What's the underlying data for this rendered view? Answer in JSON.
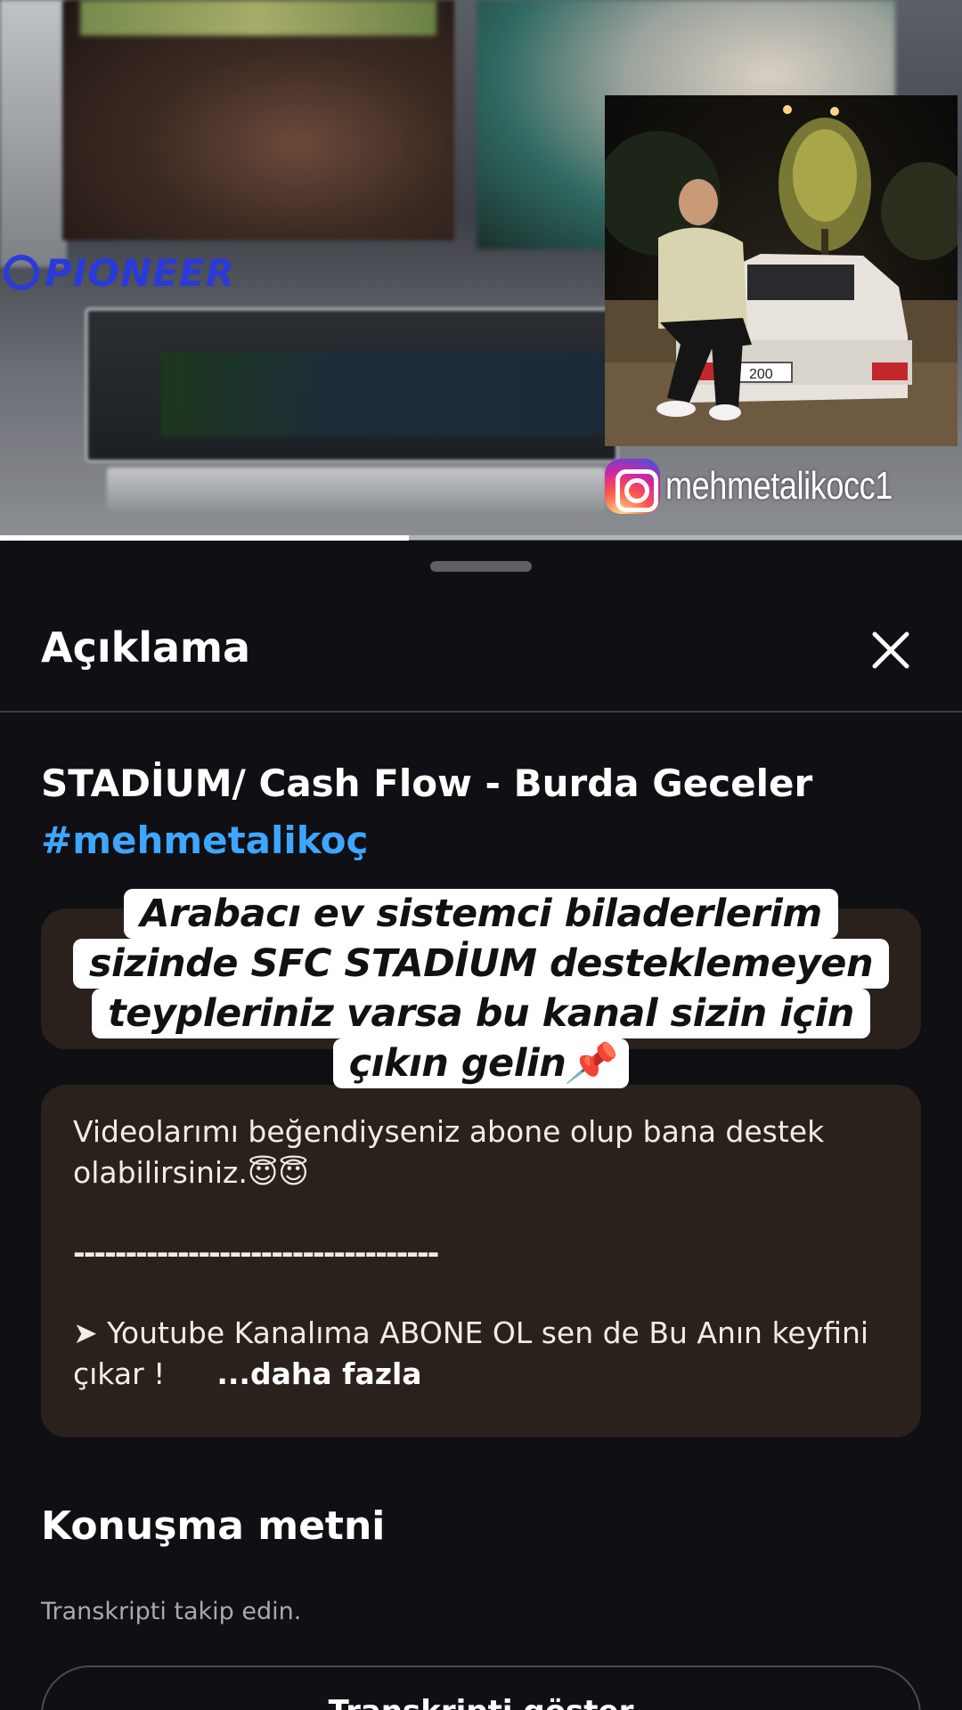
{
  "video": {
    "brand_logo_text": "PIONEER",
    "instagram_handle": "mehmetalikocc1",
    "progress": 0.425,
    "photo_plate": "200"
  },
  "sheet": {
    "title": "Açıklama",
    "video_title": "STADİUM/ Cash Flow - Burda Geceler",
    "hashtag": "#mehmetalikoç",
    "sticker_lines": [
      "Arabacı ev sistemci biladerlerim",
      "sizinde SFC STADİUM desteklemeyen",
      "teypleriniz varsa bu kanal sizin için",
      "çıkın gelin📌"
    ],
    "description": {
      "line1": "Videolarımı beğendiyseniz abone olup bana destek olabilirsiniz.😇😇",
      "divider": "-----------------------------------",
      "channel_line": "➤ Youtube Kanalıma ABONE OL sen de Bu Anın keyfini çıkar !",
      "more": "...daha fazla"
    },
    "transcript": {
      "title": "Konuşma metni",
      "subtitle": "Transkripti takip edin.",
      "button": "Transkripti göster"
    }
  }
}
